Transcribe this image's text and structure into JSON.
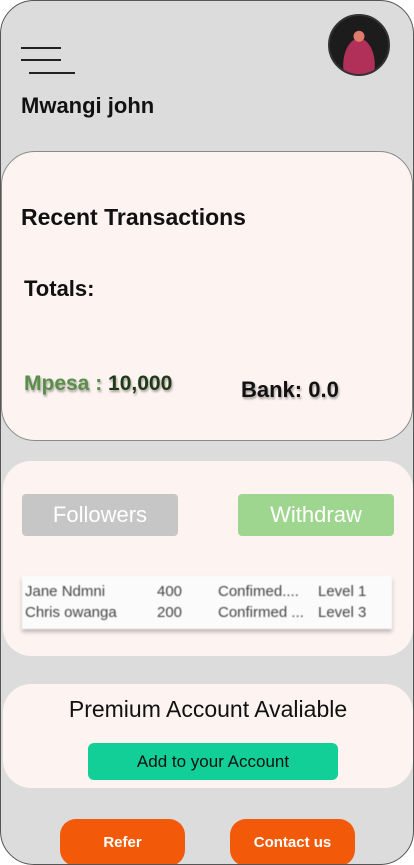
{
  "header": {
    "menu_icon": "hamburger-menu-icon",
    "username": "Mwangi john"
  },
  "summary": {
    "title": "Recent Transactions",
    "totals_label": "Totals:",
    "mpesa_label": "Mpesa : ",
    "mpesa_value": "10,000",
    "bank_text": "Bank: 0.0"
  },
  "actions": {
    "followers_label": "Followers",
    "withdraw_label": "Withdraw"
  },
  "transactions": [
    {
      "name": "Jane Ndmni",
      "amount": "400",
      "status": "Confimed....",
      "level": "Level 1"
    },
    {
      "name": "Chris owanga",
      "amount": "200",
      "status": "Confirmed ...",
      "level": "Level 3"
    }
  ],
  "premium": {
    "text": "Premium Account Avaliable",
    "button_label": "Add to your Account"
  },
  "footer": {
    "refer_label": "Refer",
    "contact_label": "Contact us"
  },
  "colors": {
    "background": "#dcdcdc",
    "card": "#fdf3f0",
    "mpesa_label": "#5a8f4a",
    "withdraw": "#9fd68f",
    "followers": "#c6c6c6",
    "add_button": "#12cf97",
    "pill_button": "#f25a0a"
  }
}
